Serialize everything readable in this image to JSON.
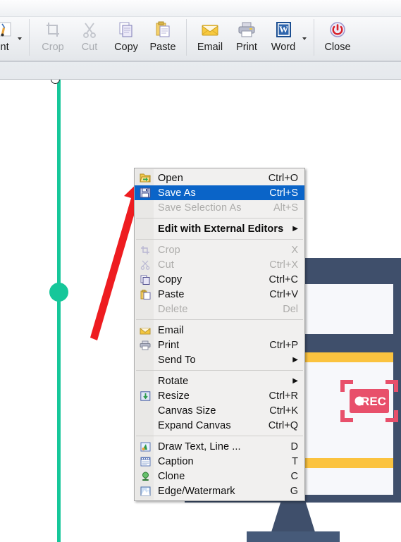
{
  "app": {
    "toolbar": {
      "buttons": [
        {
          "label": "int",
          "icon": "paint-icon",
          "disabled": false,
          "partial": true,
          "dropdown": true
        },
        {
          "label": "Crop",
          "icon": "crop-icon",
          "disabled": true,
          "dropdown": false
        },
        {
          "label": "Cut",
          "icon": "scissors-icon",
          "disabled": true,
          "dropdown": false
        },
        {
          "label": "Copy",
          "icon": "copy-icon",
          "disabled": false,
          "dropdown": false
        },
        {
          "label": "Paste",
          "icon": "paste-icon",
          "disabled": false,
          "dropdown": false
        },
        {
          "label": "Email",
          "icon": "envelope-icon",
          "disabled": false,
          "dropdown": false
        },
        {
          "label": "Print",
          "icon": "printer-icon",
          "disabled": false,
          "dropdown": false
        },
        {
          "label": "Word",
          "icon": "word-icon",
          "disabled": false,
          "dropdown": true
        },
        {
          "label": "Close",
          "icon": "power-icon",
          "disabled": false,
          "dropdown": false
        }
      ]
    },
    "context_menu": {
      "groups": [
        {
          "items": [
            {
              "label": "Open",
              "shortcut": "Ctrl+O",
              "icon": "open-folder-icon",
              "disabled": false,
              "highlighted": false,
              "submenu": false,
              "bold": false
            },
            {
              "label": "Save As",
              "shortcut": "Ctrl+S",
              "icon": "floppy-disk-icon",
              "disabled": false,
              "highlighted": true,
              "submenu": false,
              "bold": false
            },
            {
              "label": "Save Selection As",
              "shortcut": "Alt+S",
              "icon": "",
              "disabled": true,
              "highlighted": false,
              "submenu": false,
              "bold": false
            }
          ]
        },
        {
          "items": [
            {
              "label": "Edit with External Editors",
              "shortcut": "",
              "icon": "",
              "disabled": false,
              "highlighted": false,
              "submenu": true,
              "bold": true
            }
          ]
        },
        {
          "items": [
            {
              "label": "Crop",
              "shortcut": "X",
              "icon": "crop-icon",
              "disabled": true,
              "highlighted": false,
              "submenu": false,
              "bold": false
            },
            {
              "label": "Cut",
              "shortcut": "Ctrl+X",
              "icon": "scissors-icon",
              "disabled": true,
              "highlighted": false,
              "submenu": false,
              "bold": false
            },
            {
              "label": "Copy",
              "shortcut": "Ctrl+C",
              "icon": "copy-icon",
              "disabled": false,
              "highlighted": false,
              "submenu": false,
              "bold": false
            },
            {
              "label": "Paste",
              "shortcut": "Ctrl+V",
              "icon": "paste-icon",
              "disabled": false,
              "highlighted": false,
              "submenu": false,
              "bold": false
            },
            {
              "label": "Delete",
              "shortcut": "Del",
              "icon": "",
              "disabled": true,
              "highlighted": false,
              "submenu": false,
              "bold": false
            }
          ]
        },
        {
          "items": [
            {
              "label": "Email",
              "shortcut": "",
              "icon": "envelope-icon",
              "disabled": false,
              "highlighted": false,
              "submenu": false,
              "bold": false
            },
            {
              "label": "Print",
              "shortcut": "Ctrl+P",
              "icon": "printer-icon",
              "disabled": false,
              "highlighted": false,
              "submenu": false,
              "bold": false
            },
            {
              "label": "Send To",
              "shortcut": "",
              "icon": "",
              "disabled": false,
              "highlighted": false,
              "submenu": true,
              "bold": false
            }
          ]
        },
        {
          "items": [
            {
              "label": "Rotate",
              "shortcut": "",
              "icon": "",
              "disabled": false,
              "highlighted": false,
              "submenu": true,
              "bold": false
            },
            {
              "label": "Resize",
              "shortcut": "Ctrl+R",
              "icon": "resize-icon",
              "disabled": false,
              "highlighted": false,
              "submenu": false,
              "bold": false
            },
            {
              "label": "Canvas Size",
              "shortcut": "Ctrl+K",
              "icon": "",
              "disabled": false,
              "highlighted": false,
              "submenu": false,
              "bold": false
            },
            {
              "label": "Expand Canvas",
              "shortcut": "Ctrl+Q",
              "icon": "",
              "disabled": false,
              "highlighted": false,
              "submenu": false,
              "bold": false
            }
          ]
        },
        {
          "items": [
            {
              "label": "Draw Text, Line ...",
              "shortcut": "D",
              "icon": "draw-icon",
              "disabled": false,
              "highlighted": false,
              "submenu": false,
              "bold": false
            },
            {
              "label": "Caption",
              "shortcut": "T",
              "icon": "caption-icon",
              "disabled": false,
              "highlighted": false,
              "submenu": false,
              "bold": false
            },
            {
              "label": "Clone",
              "shortcut": "C",
              "icon": "clone-icon",
              "disabled": false,
              "highlighted": false,
              "submenu": false,
              "bold": false
            },
            {
              "label": "Edge/Watermark",
              "shortcut": "G",
              "icon": "edge-watermark-icon",
              "disabled": false,
              "highlighted": false,
              "submenu": false,
              "bold": false
            }
          ]
        }
      ]
    },
    "canvas": {
      "annotations": {
        "arrow": {
          "name": "red-arrow-annotation",
          "color": "#ee1c20"
        },
        "line": {
          "name": "teal-vertical-line",
          "color": "#16c79a"
        },
        "dot": {
          "name": "teal-dot-annotation",
          "color": "#16c79a"
        }
      },
      "image": {
        "name": "monitor-rec-illustration",
        "rec_label": "REC",
        "colors": {
          "frame": "#3f4f6b",
          "screen": "#f7f8fb",
          "accent": "#fbc33f",
          "rec": "#e8506b"
        }
      }
    }
  }
}
